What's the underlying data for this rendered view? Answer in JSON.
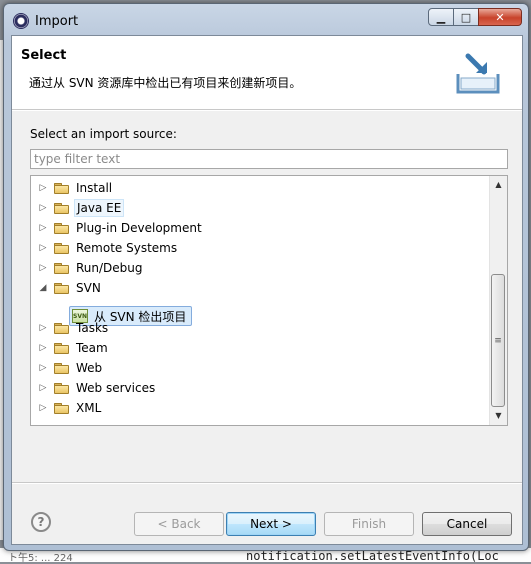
{
  "window": {
    "title": "Import",
    "controls": {
      "minimize": "▁",
      "maximize": "□",
      "close": "✕"
    }
  },
  "header": {
    "title": "Select",
    "description": "通过从 SVN 资源库中检出已有项目来创建新项目。",
    "icon": "import-wizard-icon"
  },
  "source": {
    "label": "Select an import source:",
    "filter_placeholder": "type filter text",
    "filter_value": ""
  },
  "tree": {
    "nodes": [
      {
        "label": "Install",
        "expanded": false
      },
      {
        "label": "Java EE",
        "expanded": false
      },
      {
        "label": "Plug-in Development",
        "expanded": false
      },
      {
        "label": "Remote Systems",
        "expanded": false
      },
      {
        "label": "Run/Debug",
        "expanded": false
      },
      {
        "label": "SVN",
        "expanded": true,
        "children": [
          {
            "label": "从 SVN 检出项目",
            "selected": true,
            "icon": "svn-checkout-icon"
          }
        ]
      },
      {
        "label": "Tasks",
        "expanded": false
      },
      {
        "label": "Team",
        "expanded": false
      },
      {
        "label": "Web",
        "expanded": false
      },
      {
        "label": "Web services",
        "expanded": false
      },
      {
        "label": "XML",
        "expanded": false
      }
    ],
    "scroll_position": 0.6
  },
  "buttons": {
    "help": "?",
    "back": "< Back",
    "next": "Next >",
    "finish": "Finish",
    "cancel": "Cancel"
  },
  "background": {
    "code_text": "notification.setLatestEventInfo(Loc",
    "left_text": "ト午5:  ...  224"
  }
}
